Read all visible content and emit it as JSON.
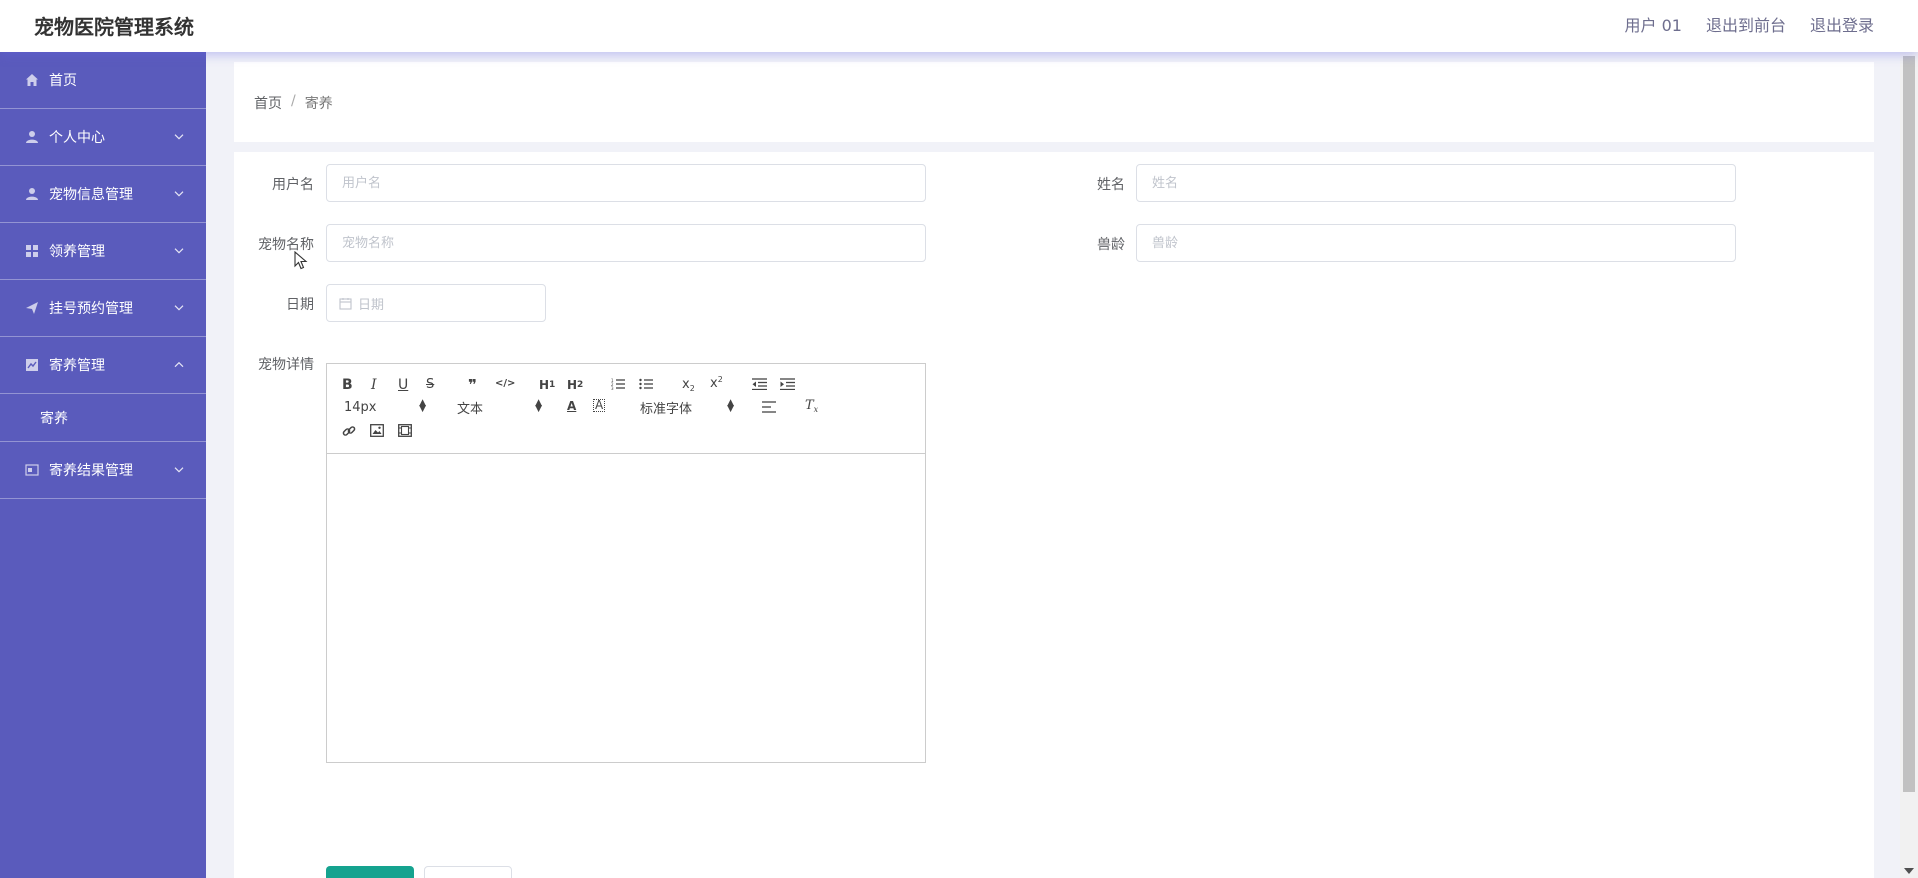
{
  "app": {
    "title": "宠物医院管理系统"
  },
  "header": {
    "user": "用户 01",
    "to_front": "退出到前台",
    "logout": "退出登录"
  },
  "sidebar": {
    "items": [
      {
        "label": "首页",
        "icon": "home-icon"
      },
      {
        "label": "个人中心",
        "icon": "user-icon"
      },
      {
        "label": "宠物信息管理",
        "icon": "user-icon"
      },
      {
        "label": "领养管理",
        "icon": "grid-icon"
      },
      {
        "label": "挂号预约管理",
        "icon": "send-icon"
      },
      {
        "label": "寄养管理",
        "icon": "chart-icon",
        "expanded": true
      },
      {
        "label": "寄养",
        "sub": true
      },
      {
        "label": "寄养结果管理",
        "icon": "card-icon"
      }
    ]
  },
  "breadcrumb": {
    "home": "首页",
    "sep": "/",
    "current": "寄养"
  },
  "form": {
    "username_label": "用户名",
    "username_placeholder": "用户名",
    "name_label": "姓名",
    "name_placeholder": "姓名",
    "petname_label": "宠物名称",
    "petname_placeholder": "宠物名称",
    "age_label": "兽龄",
    "age_placeholder": "兽龄",
    "date_label": "日期",
    "date_placeholder": "日期",
    "detail_label": "宠物详情"
  },
  "editor": {
    "size": "14px",
    "format": "文本",
    "font": "标准字体"
  },
  "colors": {
    "sidebar": "#5a5bbc",
    "submit": "#15a38f"
  }
}
